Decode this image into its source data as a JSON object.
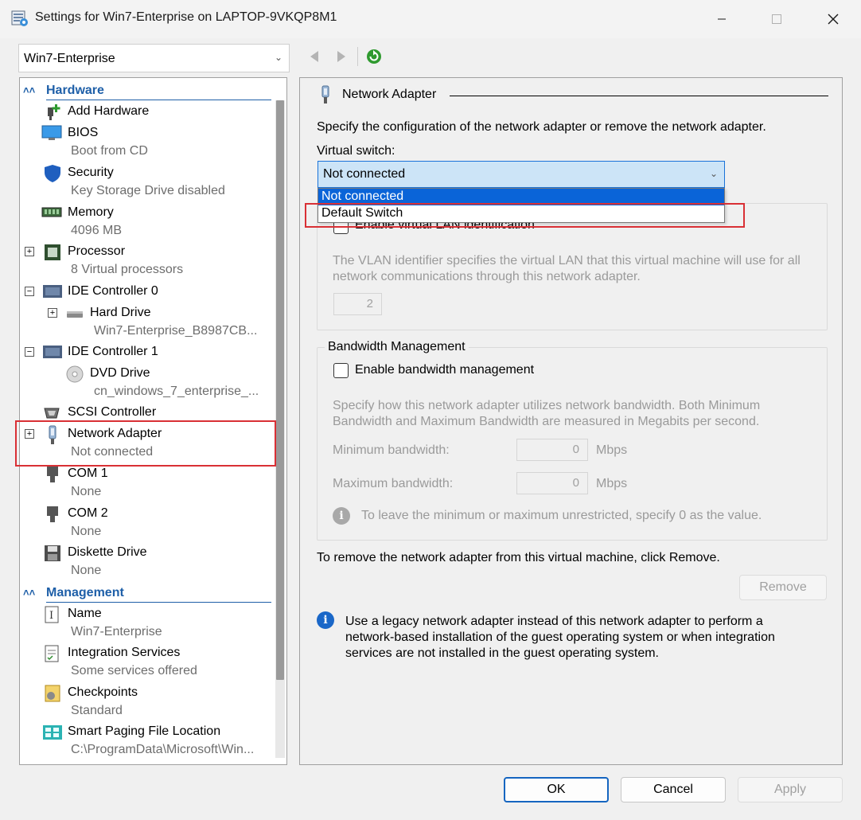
{
  "window": {
    "title": "Settings for Win7-Enterprise on LAPTOP-9VKQP8M1"
  },
  "vm_selector": {
    "value": "Win7-Enterprise"
  },
  "tree": {
    "hardware_label": "Hardware",
    "management_label": "Management",
    "items": [
      {
        "name": "Add Hardware",
        "sub": "",
        "icon": "add-hardware-icon"
      },
      {
        "name": "BIOS",
        "sub": "Boot from CD",
        "icon": "bios-icon"
      },
      {
        "name": "Security",
        "sub": "Key Storage Drive disabled",
        "icon": "shield-icon"
      },
      {
        "name": "Memory",
        "sub": "4096 MB",
        "icon": "memory-icon"
      },
      {
        "name": "Processor",
        "sub": "8 Virtual processors",
        "icon": "processor-icon"
      },
      {
        "name": "IDE Controller 0",
        "sub": "",
        "icon": "ide-controller-icon"
      },
      {
        "name": "Hard Drive",
        "sub": "Win7-Enterprise_B8987CB...",
        "icon": "hard-drive-icon"
      },
      {
        "name": "IDE Controller 1",
        "sub": "",
        "icon": "ide-controller-icon"
      },
      {
        "name": "DVD Drive",
        "sub": "cn_windows_7_enterprise_...",
        "icon": "dvd-icon"
      },
      {
        "name": "SCSI Controller",
        "sub": "",
        "icon": "scsi-icon"
      },
      {
        "name": "Network Adapter",
        "sub": "Not connected",
        "icon": "network-adapter-icon"
      },
      {
        "name": "COM 1",
        "sub": "None",
        "icon": "com-port-icon"
      },
      {
        "name": "COM 2",
        "sub": "None",
        "icon": "com-port-icon"
      },
      {
        "name": "Diskette Drive",
        "sub": "None",
        "icon": "floppy-icon"
      }
    ],
    "management_items": [
      {
        "name": "Name",
        "sub": "Win7-Enterprise",
        "icon": "name-icon"
      },
      {
        "name": "Integration Services",
        "sub": "Some services offered",
        "icon": "integration-icon"
      },
      {
        "name": "Checkpoints",
        "sub": "Standard",
        "icon": "checkpoint-icon"
      },
      {
        "name": "Smart Paging File Location",
        "sub": "C:\\ProgramData\\Microsoft\\Win...",
        "icon": "paging-icon"
      }
    ]
  },
  "panel": {
    "heading": "Network Adapter",
    "description": "Specify the configuration of the network adapter or remove the network adapter.",
    "virtual_switch_label": "Virtual switch:",
    "virtual_switch_value": "Not connected",
    "dropdown_options": [
      "Not connected",
      "Default Switch"
    ],
    "vlan_checkbox_label": "Enable virtual LAN identification",
    "vlan_description": "The VLAN identifier specifies the virtual LAN that this virtual machine will use for all network communications through this network adapter.",
    "vlan_id": "2",
    "bandwidth_title": "Bandwidth Management",
    "bandwidth_checkbox_label": "Enable bandwidth management",
    "bandwidth_description": "Specify how this network adapter utilizes network bandwidth. Both Minimum Bandwidth and Maximum Bandwidth are measured in Megabits per second.",
    "min_label": "Minimum bandwidth:",
    "min_value": "0",
    "max_label": "Maximum bandwidth:",
    "max_value": "0",
    "unit": "Mbps",
    "bandwidth_tip": "To leave the minimum or maximum unrestricted, specify 0 as the value.",
    "remove_text": "To remove the network adapter from this virtual machine, click Remove.",
    "remove_button": "Remove",
    "legacy_info": "Use a legacy network adapter instead of this network adapter to perform a network-based installation of the guest operating system or when integration services are not installed in the guest operating system."
  },
  "footer": {
    "ok": "OK",
    "cancel": "Cancel",
    "apply": "Apply"
  },
  "colors": {
    "accent": "#1e5fa8",
    "selection": "#0a64d8",
    "highlight": "#d93035"
  }
}
